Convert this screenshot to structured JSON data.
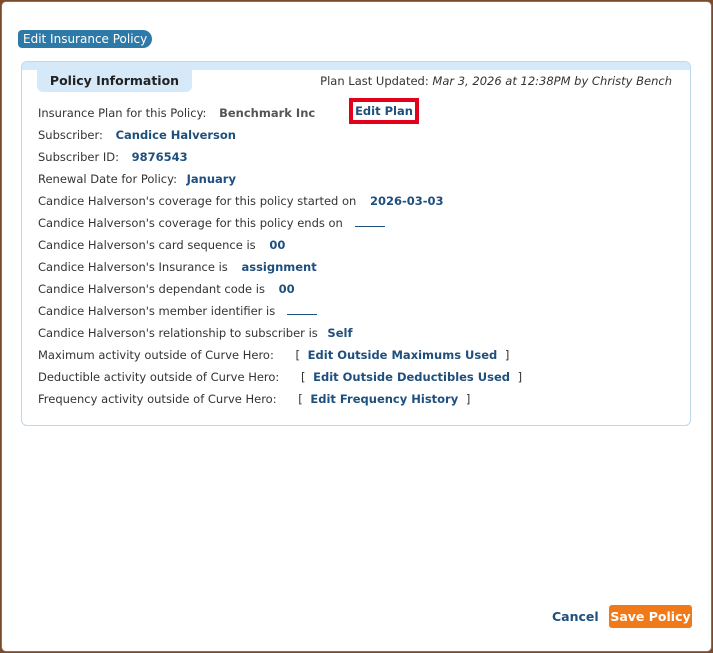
{
  "dialog": {
    "title": "Edit Insurance Policy"
  },
  "panel": {
    "tab_label": "Policy Information",
    "updated_label": "Plan Last Updated:",
    "updated_value": "Mar 3, 2026 at 12:38PM by Christy Bench"
  },
  "plan": {
    "label": "Insurance Plan for this Policy:",
    "value": "Benchmark Inc",
    "edit_label": "Edit Plan"
  },
  "rows": {
    "subscriber_label": "Subscriber:",
    "subscriber_value": "Candice Halverson",
    "subscriber_id_label": "Subscriber ID:",
    "subscriber_id_value": "9876543",
    "renewal_label": "Renewal Date for Policy:",
    "renewal_value": "January",
    "started_label": "Candice Halverson's coverage for this policy started on",
    "started_value": "2026-03-03",
    "ends_label": "Candice Halverson's coverage for this policy ends on",
    "card_seq_label": "Candice Halverson's card sequence is",
    "card_seq_value": "00",
    "insurance_label": "Candice Halverson's Insurance is",
    "insurance_value": "assignment",
    "dependant_label": "Candice Halverson's dependant code is",
    "dependant_value": "00",
    "member_label": "Candice Halverson's member identifier is",
    "relationship_label": "Candice Halverson's relationship to subscriber is",
    "relationship_value": "Self",
    "max_label": "Maximum activity outside of Curve Hero:",
    "max_link": "Edit Outside Maximums Used",
    "ded_label": "Deductible activity outside of Curve Hero:",
    "ded_link": "Edit Outside Deductibles Used",
    "freq_label": "Frequency activity outside of Curve Hero:",
    "freq_link": "Edit Frequency History",
    "open_bracket": "[",
    "close_bracket": "]"
  },
  "footer": {
    "cancel_label": "Cancel",
    "save_label": "Save Policy"
  }
}
